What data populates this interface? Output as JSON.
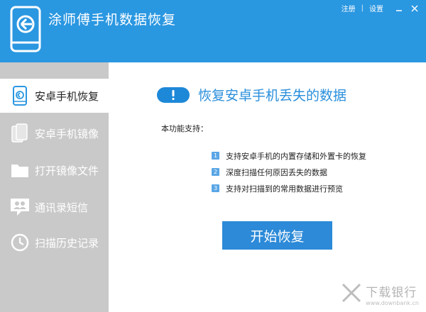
{
  "header": {
    "title": "涂师傅手机数据恢复",
    "links": {
      "register": "注册",
      "separator": "|",
      "settings": "设置"
    }
  },
  "sidebar": {
    "items": [
      {
        "label": "安卓手机恢复",
        "icon": "phone-restore-icon",
        "active": true
      },
      {
        "label": "安卓手机镜像",
        "icon": "phone-mirror-icon",
        "active": false
      },
      {
        "label": "打开镜像文件",
        "icon": "folder-icon",
        "active": false
      },
      {
        "label": "通讯录短信",
        "icon": "contacts-icon",
        "active": false
      },
      {
        "label": "扫描历史记录",
        "icon": "clock-icon",
        "active": false
      }
    ]
  },
  "main": {
    "hero_title": "恢复安卓手机丢失的数据",
    "support_label": "本功能支持：",
    "features": [
      {
        "num": "1",
        "text": "支持安卓手机的内置存储和外置卡的恢复"
      },
      {
        "num": "2",
        "text": "深度扫描任何原因丢失的数据"
      },
      {
        "num": "3",
        "text": "支持对扫描到的常用数据进行预览"
      }
    ],
    "start_button": "开始恢复"
  },
  "watermark": {
    "text": "下载银行",
    "url": "www.downbank.cn"
  },
  "colors": {
    "accent": "#2a97e1",
    "sidebar": "#c9c9c9",
    "button": "#2c8ad8"
  }
}
